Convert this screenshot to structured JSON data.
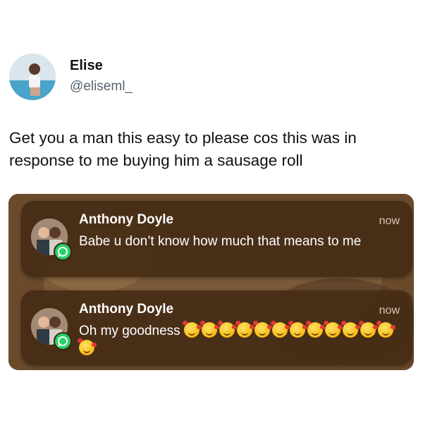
{
  "tweet": {
    "author": {
      "name": "Elise",
      "handle": "@eliseml_"
    },
    "text": "Get you a man this easy to please cos this was in response to me buying him a sausage roll"
  },
  "notifications": [
    {
      "sender": "Anthony Doyle",
      "time": "now",
      "message": "Babe u don’t  know how much that means to me",
      "app_icon": "whatsapp-icon"
    },
    {
      "sender": "Anthony Doyle",
      "time": "now",
      "message": "Oh my goodness",
      "emoji_count": 13,
      "emoji_name": "smiling-face-with-hearts-emoji",
      "app_icon": "whatsapp-icon"
    }
  ],
  "colors": {
    "handle": "#536471",
    "notification_bg": "#462c16",
    "whatsapp_green": "#25d366"
  }
}
